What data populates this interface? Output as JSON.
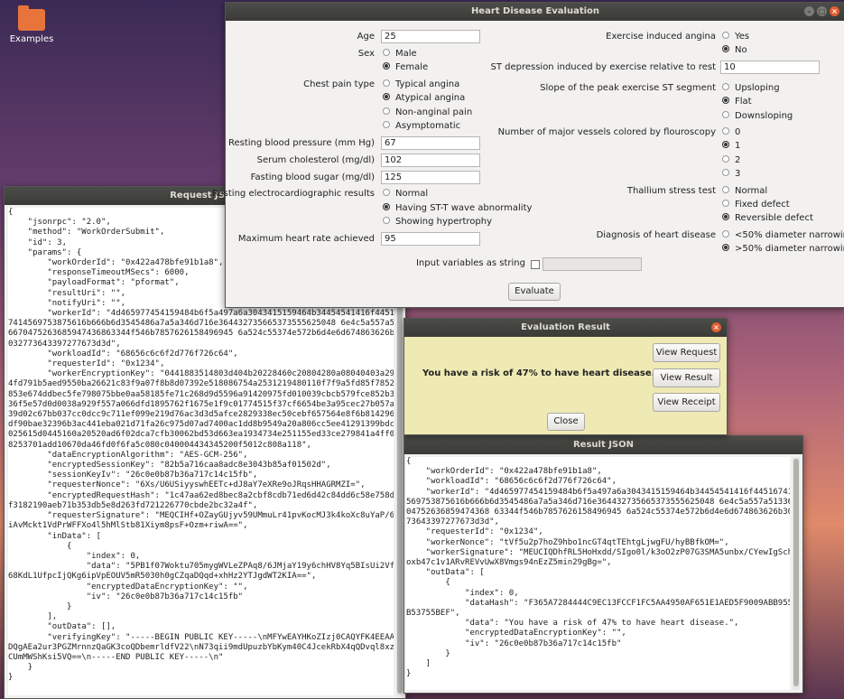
{
  "desktop": {
    "icon_label": "Examples"
  },
  "main_window": {
    "title": "Heart Disease Evaluation",
    "age_label": "Age",
    "age_value": "25",
    "sex_label": "Sex",
    "sex_options": [
      "Male",
      "Female"
    ],
    "sex_selected": "Female",
    "chest_label": "Chest pain type",
    "chest_options": [
      "Typical angina",
      "Atypical angina",
      "Non-anginal pain",
      "Asymptomatic"
    ],
    "chest_selected": "Atypical angina",
    "bp_label": "Resting blood pressure (mm Hg)",
    "bp_value": "67",
    "chol_label": "Serum cholesterol (mg/dl)",
    "chol_value": "102",
    "sugar_label": "Fasting blood sugar (mg/dl)",
    "sugar_value": "125",
    "ecg_label": "Resting electrocardiographic results",
    "ecg_options": [
      "Normal",
      "Having ST-T wave abnormality",
      "Showing hypertrophy"
    ],
    "ecg_selected": "Having ST-T wave abnormality",
    "hr_label": "Maximum heart rate achieved",
    "hr_value": "95",
    "angina_label": "Exercise induced angina",
    "angina_options": [
      "Yes",
      "No"
    ],
    "angina_selected": "No",
    "st_label": "ST depression induced by exercise relative to rest",
    "st_value": "10",
    "slope_label": "Slope of the peak exercise ST segment",
    "slope_options": [
      "Upsloping",
      "Flat",
      "Downsloping"
    ],
    "slope_selected": "Flat",
    "vessels_label": "Number of major vessels colored by flouroscopy",
    "vessels_options": [
      "0",
      "1",
      "2",
      "3"
    ],
    "vessels_selected": "1",
    "thal_label": "Thallium stress test",
    "thal_options": [
      "Normal",
      "Fixed defect",
      "Reversible defect"
    ],
    "thal_selected": "Reversible defect",
    "diag_label": "Diagnosis of heart disease",
    "diag_options": [
      "<50% diameter narrowing",
      ">50% diameter narrowing"
    ],
    "diag_selected": ">50% diameter narrowing",
    "input_string_label": "Input variables as string",
    "evaluate_label": "Evaluate"
  },
  "request_window": {
    "title": "Request JSON",
    "text": "{\n    \"jsonrpc\": \"2.0\",\n    \"method\": \"WorkOrderSubmit\",\n    \"id\": 3,\n    \"params\": {\n        \"workOrderId\": \"0x422a478bfe91b1a8\",\n        \"responseTimeoutMSecs\": 6000,\n        \"payloadFormat\": \"pformat\",\n        \"resultUri\": \"\",\n        \"notifyUri\": \"\",\n        \"workerId\": \"4d465977454159484b6f5a497a6a3043415159464b34454541416f445167414\n7414569753875616b666b6d3545486a7a5a346d716e364432735665373555625048 6e4c5a557a5133\n6670475263685947436863344f546b7857626158496945 6a524c55374e572b6d4e6d674863626b3\n032773643397277673d3d\",\n        \"workloadId\": \"68656c6c6f2d776f726c64\",\n        \"requesterId\": \"0x1234\",\n        \"workerEncryptionKey\": \"0441883514803d404b20228460c20804280a08040403a293\n4fd791b5aed9550ba26621c83f9a07f8b8d07392e518086754a2531219480110f7f9a5fd85f78527\n853e674ddbec5fe798075bbe0aa58185fe71c268d9d5596a91420975fd010039cbcb579fce852b37\n36f5e57d0d0038a929f557a066dfd1895762f1675e1f9c01774515f37cf6654be3a95cec27b057a\n39d02c67bb037cc0dcc9c711ef099e219d76ac3d3d5afce2829338ec50cebf657564e8f6b814296b\ndf90bae32396b3ac441eba021d71fa26c975d07ad7400ac1dd8b9549a20a806cc5ee41291399bdc5\n025615d0445160a20520ad6f02dca7cfb30062bd53d663ea1934734e251155ed33ce279841a4ff067\n8253701add10670da46fd0f6fa5c080c040004434345200f5012c808a118\",\n        \"dataEncryptionAlgorithm\": \"AES-GCM-256\",\n        \"encryptedSessionKey\": \"82b5a716caa8adc8e3043b85af01502d\",\n        \"sessionKeyIv\": \"26c0e0b87b36a717c14c15fb\",\n        \"requesterNonce\": \"6Xs/U6USiyyswhEETc+dJ8aY7eXRe9oJRqsHHAGRMZI=\",\n        \"encryptedRequestHash\": \"1c47aa62ed8bec8a2cbf8cdb71ed6d42c84dd6c58e758de\nf3182190aeb71b353db5e8d263fd721226770cbde2bc32a4f\",\n        \"requesterSignature\": \"MEQCIHf+OZayGUjyv59UMmuLr41pvKocMJ3k4koXc8uYaP/6A\niAvMckt1VdPrWFFXo4l5hMlStb81Xiym8psF+Ozm+riwA==\",\n        \"inData\": [\n            {\n                \"index\": 0,\n                \"data\": \"5PB1f07Woktu705mygWVLeZPAq8/6JMjaY19y6chHV8Yq5BIsUi2VfE\n68KdL1UfpcIjQKg6ipVpEOUV5mR5030h0gCZqaDQqd+xhHz2YTJgdWT2KIA==\",\n                \"encryptedDataEncryptionKey\": \"\",\n                \"iv\": \"26c0e0b87b36a717c14c15fb\"\n            }\n        ],\n        \"outData\": [],\n        \"verifyingKey\": \"-----BEGIN PUBLIC KEY-----\\nMFYwEAYHKoZIzj0CAQYFK4EEAAo\nDQgAEa2ur3PGZMrnnzQaGK3coQDbemrldfV22\\nN73qii9mdUpuzbYbKym40C4JcekRbX4qQDvql8xzA\nCUmMWShKsi5VQ==\\n-----END PUBLIC KEY-----\\n\"\n    }\n}"
  },
  "eval_window": {
    "title": "Evaluation Result",
    "result_text": "You have a risk of 47% to have heart disease.",
    "view_request": "View Request",
    "view_result": "View Result",
    "view_receipt": "View Receipt",
    "close": "Close"
  },
  "result_window": {
    "title": "Result JSON",
    "text": "{\n    \"workOrderId\": \"0x422a478bfe91b1a8\",\n    \"workloadId\": \"68656c6c6f2d776f726c64\",\n    \"workerId\": \"4d465977454159484b6f5a497a6a3043415159464b34454541416f445167414\n569753875616b666b6d3545486a7a5a346d716e364432735665373555625048 6e4c5a557a5133667\n04752636859474368 63344f546b7857626158496945 6a524c55374e572b6d4e6d674863626b30327\n73643397277673d3d\",\n    \"requesterId\": \"0x1234\",\n    \"workerNonce\": \"tVf5u2p7hoZ9hbo1ncGT4qtTEhtgLjwgFU/hyBBfkOM=\",\n    \"workerSignature\": \"MEUCIQDhfRL5HoHxdd/SIgo0l/k3oO2zP07G3SMA5unbx/CYewIgSchv\noxb47c1v1ARvREVvUwX8Vmgs94nEzZ5min29gBg=\",\n    \"outData\": [\n        {\n            \"index\": 0,\n            \"dataHash\": \"F365A7284444C9EC13FCCF1FC5AA4950AF651E1AED5F9009ABB9553\nB53755BEF\",\n            \"data\": \"You have a risk of 47% to have heart disease.\",\n            \"encryptedDataEncryptionKey\": \"\",\n            \"iv\": \"26c0e0b87b36a717c14c15fb\"\n        }\n    ]\n}"
  }
}
